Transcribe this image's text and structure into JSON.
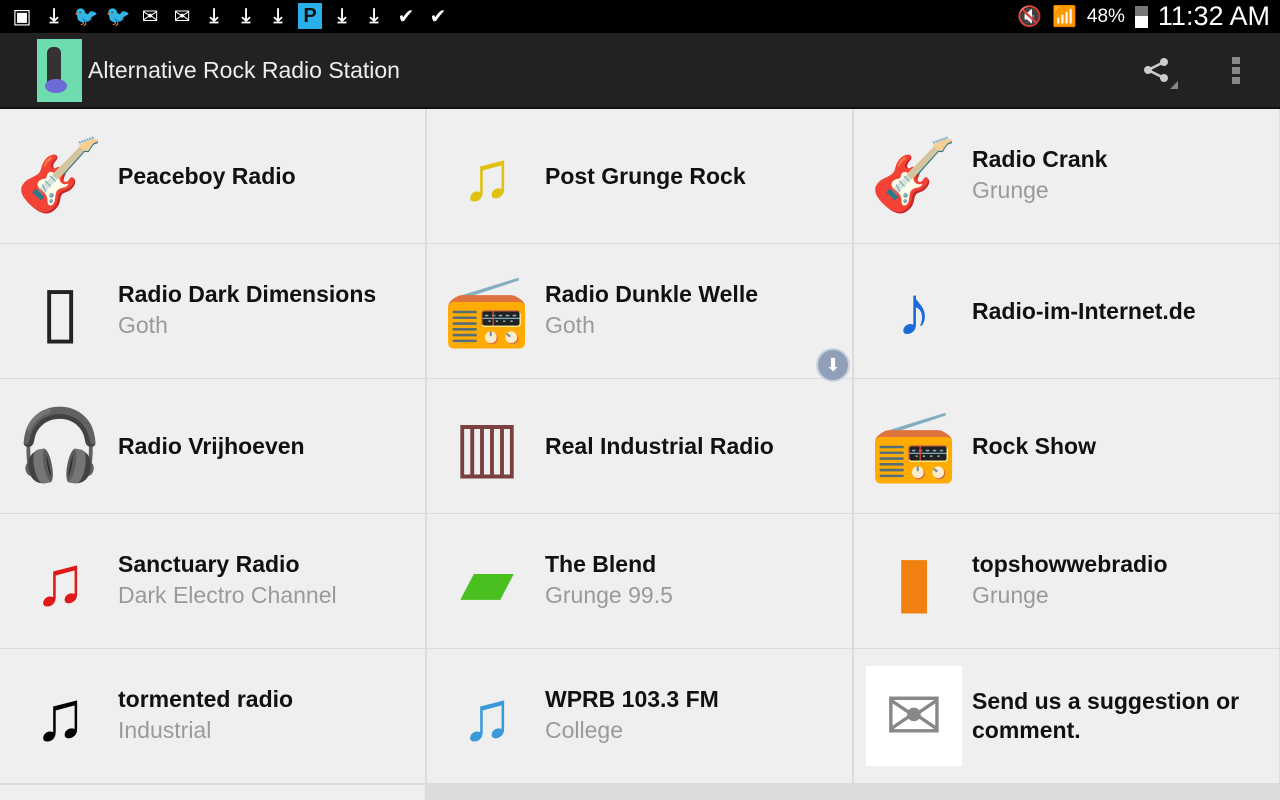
{
  "status_bar": {
    "icons": [
      "gallery-icon",
      "download-icon",
      "twitter-icon",
      "twitter-icon",
      "email-icon",
      "email-icon",
      "download-icon",
      "download-icon",
      "download-icon",
      "picsart-icon",
      "download-icon",
      "download-icon",
      "clipboard-check-icon",
      "clipboard-multi-icon"
    ],
    "battery_percent": "48%",
    "battery_level": 48,
    "time": "11:32 AM"
  },
  "action_bar": {
    "title": "Alternative Rock Radio Station",
    "actions": [
      "share-icon",
      "overflow-menu-icon"
    ]
  },
  "stations": [
    {
      "name": "Peaceboy Radio",
      "sub": "",
      "icon": "guitarist-icon",
      "glyph": "🎸",
      "color": "#2a7a2a"
    },
    {
      "name": "Post Grunge Rock",
      "sub": "",
      "icon": "music-notes-icon",
      "glyph": "♫",
      "color": "#e0c010"
    },
    {
      "name": "Radio Crank",
      "sub": "Grunge",
      "icon": "electric-guitar-icon",
      "glyph": "🎸",
      "color": "#e02020"
    },
    {
      "name": "Radio Dark Dimensions",
      "sub": "Goth",
      "icon": "ipod-icon",
      "glyph": "▯",
      "color": "#222222"
    },
    {
      "name": "Radio Dunkle Welle",
      "sub": "Goth",
      "icon": "boombox-icon",
      "glyph": "📻",
      "color": "#333333"
    },
    {
      "name": "Radio-im-Internet.de",
      "sub": "",
      "icon": "blue-note-icon",
      "glyph": "♪",
      "color": "#1a6ad8"
    },
    {
      "name": "Radio Vrijhoeven",
      "sub": "",
      "icon": "headphones-player-icon",
      "glyph": "🎧",
      "color": "#4a7ac8"
    },
    {
      "name": "Real Industrial Radio",
      "sub": "",
      "icon": "stereo-system-icon",
      "glyph": "▥",
      "color": "#7a4040"
    },
    {
      "name": "Rock Show",
      "sub": "",
      "icon": "radio-icon",
      "glyph": "📻",
      "color": "#777777"
    },
    {
      "name": "Sanctuary Radio",
      "sub": "Dark Electro Channel",
      "icon": "red-note-icon",
      "glyph": "♫",
      "color": "#e01818"
    },
    {
      "name": "The Blend",
      "sub": "Grunge 99.5",
      "icon": "green-folder-icon",
      "glyph": "▰",
      "color": "#4ac020"
    },
    {
      "name": "topshowwebradio",
      "sub": "Grunge",
      "icon": "mp3-player-icon",
      "glyph": "▮",
      "color": "#f08010"
    },
    {
      "name": "tormented radio",
      "sub": "Industrial",
      "icon": "black-notes-icon",
      "glyph": "♫",
      "color": "#000000"
    },
    {
      "name": "WPRB 103.3 FM",
      "sub": "College",
      "icon": "music-folder-icon",
      "glyph": "♫",
      "color": "#3a9ad8"
    },
    {
      "name": "Send us a suggestion or comment.",
      "sub": "",
      "icon": "envelope-icon",
      "glyph": "✉",
      "color": "#888888"
    }
  ]
}
